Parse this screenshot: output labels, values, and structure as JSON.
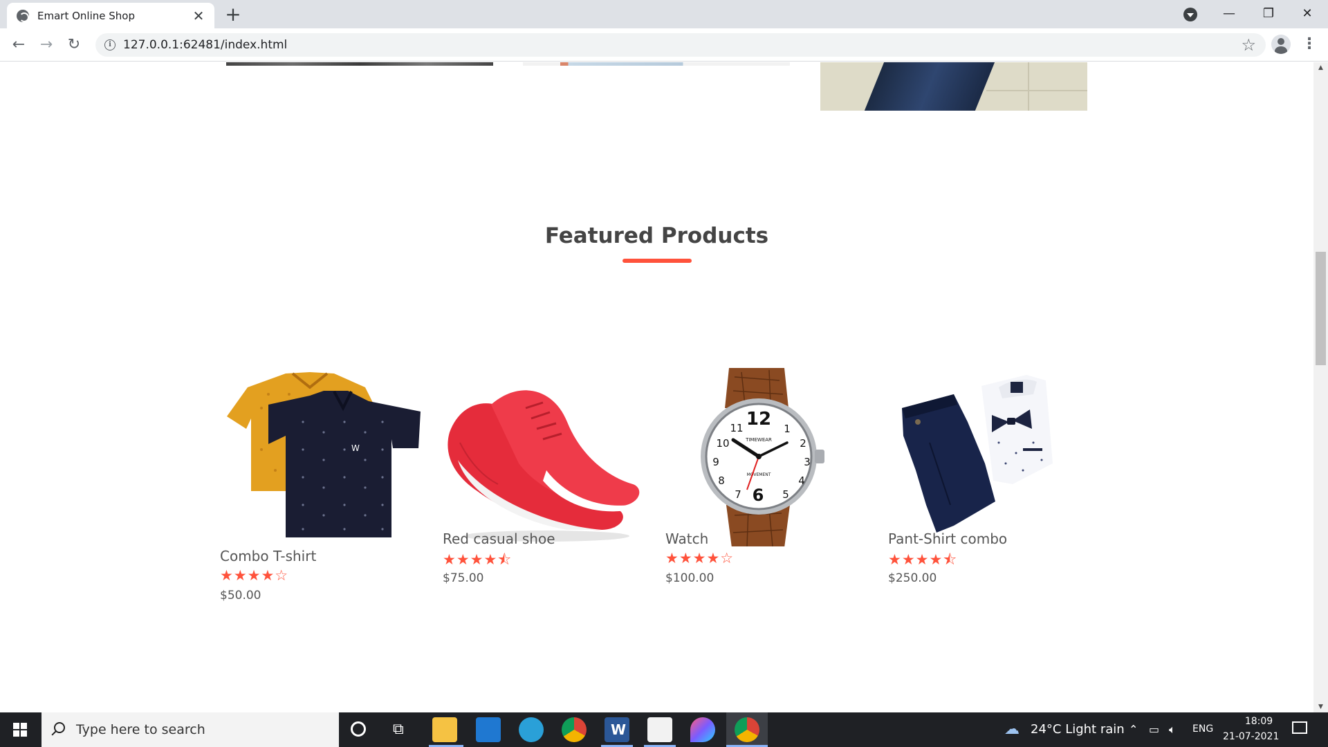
{
  "browser": {
    "tab_title": "Emart Online Shop",
    "tab_close": "✕",
    "new_tab": "+",
    "url": "127.0.0.1:62481/index.html",
    "window_controls": {
      "minimize": "—",
      "restore": "❐",
      "close": "✕"
    },
    "nav": {
      "back": "←",
      "forward": "→",
      "reload": "↻"
    }
  },
  "page": {
    "section_title": "Featured Products",
    "accent_color": "#ff523b",
    "products": [
      {
        "name": "Combo T-shirt",
        "rating": 4,
        "rating_stars": "★★★★☆",
        "price": "$50.00",
        "icon": "polo-tshirt-image"
      },
      {
        "name": "Red casual shoe",
        "rating": 4.5,
        "rating_stars": "★★★★⯪",
        "price": "$75.00",
        "icon": "red-shoe-image"
      },
      {
        "name": "Watch",
        "rating": 4,
        "rating_stars": "★★★★☆",
        "price": "$100.00",
        "icon": "watch-image"
      },
      {
        "name": "Pant-Shirt combo",
        "rating": 4.5,
        "rating_stars": "★★★★⯪",
        "price": "$250.00",
        "icon": "pant-shirt-image"
      }
    ]
  },
  "taskbar": {
    "search_placeholder": "Type here to search",
    "weather": "24°C  Light rain",
    "language": "ENG",
    "time": "18:09",
    "date": "21-07-2021"
  }
}
